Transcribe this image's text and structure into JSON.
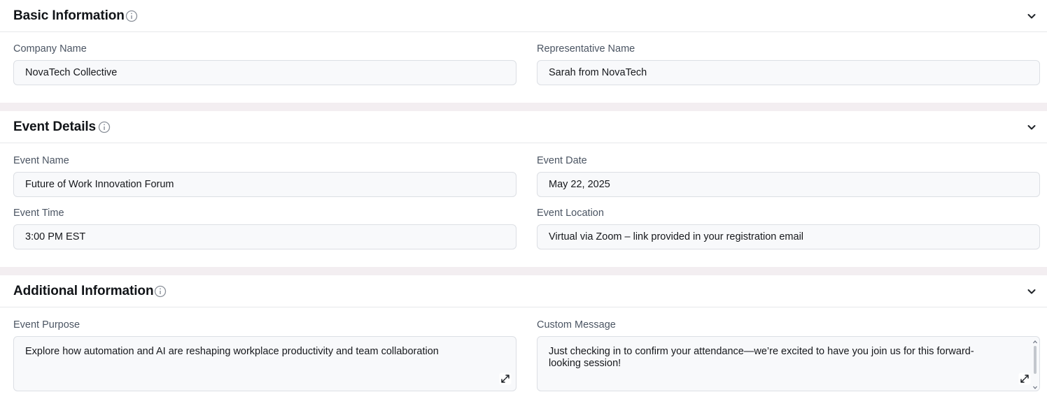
{
  "sections": {
    "basic": {
      "title": "Basic Information",
      "company_label": "Company Name",
      "company_value": "NovaTech Collective",
      "rep_label": "Representative Name",
      "rep_value": "Sarah from NovaTech"
    },
    "event": {
      "title": "Event Details",
      "name_label": "Event Name",
      "name_value": "Future of Work Innovation Forum",
      "date_label": "Event Date",
      "date_value": "May 22, 2025",
      "time_label": "Event Time",
      "time_value": "3:00 PM EST",
      "location_label": "Event Location",
      "location_value": "Virtual via Zoom – link provided in your registration email"
    },
    "additional": {
      "title": "Additional Information",
      "purpose_label": "Event Purpose",
      "purpose_value": "Explore how automation and AI are reshaping workplace productivity and team collaboration",
      "message_label": "Custom Message",
      "message_value": "Just checking in to confirm your attendance—we’re excited to have you join us for this forward-looking session!"
    }
  },
  "icons": {
    "info": "info-icon",
    "collapse": "chevron-down-icon",
    "expand": "expand-icon"
  },
  "colors": {
    "page_bg": "#f3eef1",
    "section_bg": "#ffffff",
    "input_bg": "#f8f9fb",
    "border": "#dcdfe4",
    "label": "#4b5563"
  }
}
